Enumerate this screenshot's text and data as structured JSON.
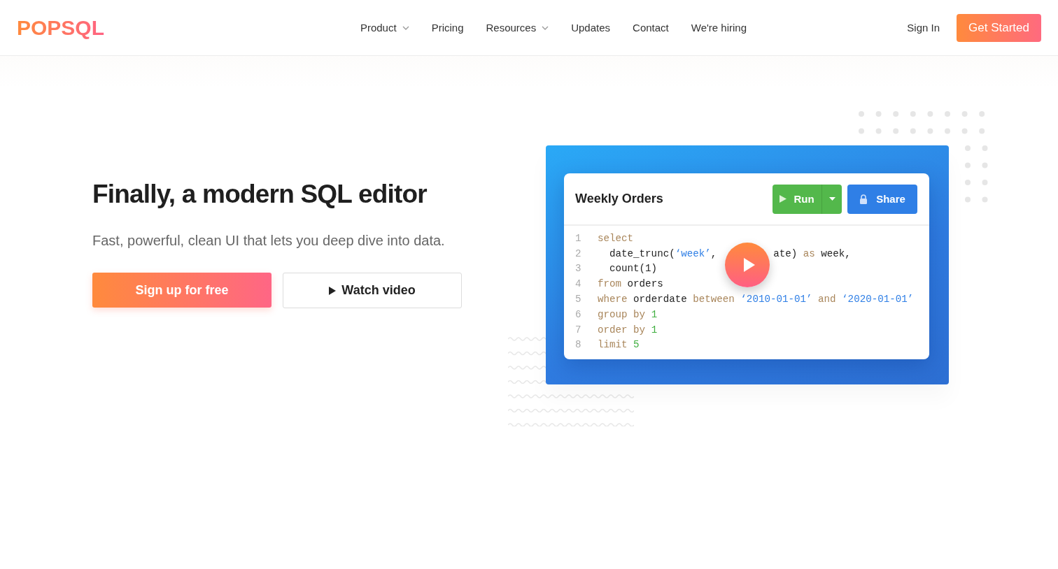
{
  "header": {
    "logo": "POPSQL",
    "nav": [
      {
        "label": "Product",
        "has_menu": true
      },
      {
        "label": "Pricing",
        "has_menu": false
      },
      {
        "label": "Resources",
        "has_menu": true
      },
      {
        "label": "Updates",
        "has_menu": false
      },
      {
        "label": "Contact",
        "has_menu": false
      },
      {
        "label": "We're hiring",
        "has_menu": false
      }
    ],
    "sign_in": "Sign In",
    "cta": "Get Started"
  },
  "hero": {
    "title": "Finally, a modern SQL editor",
    "subtitle": "Fast, powerful, clean UI that lets you deep dive into data.",
    "primary_button": "Sign up for free",
    "video_button": "Watch video"
  },
  "editor": {
    "title": "Weekly Orders",
    "run_button": "Run",
    "share_button": "Share",
    "lines": [
      {
        "number": "1",
        "tokens": [
          {
            "kind": "keyword",
            "text": "select"
          }
        ]
      },
      {
        "number": "2",
        "tokens": [
          {
            "kind": "plain",
            "text": "  date_trunc("
          },
          {
            "kind": "string",
            "text": "‘week’"
          },
          {
            "kind": "plain",
            "text": ", "
          },
          {
            "kind": "plain",
            "text": "ate)",
            "gap": true
          },
          {
            "kind": "keyword",
            "text": " as "
          },
          {
            "kind": "plain",
            "text": "week,"
          }
        ]
      },
      {
        "number": "3",
        "tokens": [
          {
            "kind": "plain",
            "text": "  count(1)"
          }
        ]
      },
      {
        "number": "4",
        "tokens": [
          {
            "kind": "keyword",
            "text": "from "
          },
          {
            "kind": "plain",
            "text": "orders"
          }
        ]
      },
      {
        "number": "5",
        "tokens": [
          {
            "kind": "keyword",
            "text": "where "
          },
          {
            "kind": "plain",
            "text": "orderdate "
          },
          {
            "kind": "keyword",
            "text": "between "
          },
          {
            "kind": "string",
            "text": "‘2010-01-01’"
          },
          {
            "kind": "keyword",
            "text": " and "
          },
          {
            "kind": "string",
            "text": "‘2020-01-01’"
          }
        ]
      },
      {
        "number": "6",
        "tokens": [
          {
            "kind": "keyword",
            "text": "group by "
          },
          {
            "kind": "number",
            "text": "1"
          }
        ]
      },
      {
        "number": "7",
        "tokens": [
          {
            "kind": "keyword",
            "text": "order by "
          },
          {
            "kind": "number",
            "text": "1"
          }
        ]
      },
      {
        "number": "8",
        "tokens": [
          {
            "kind": "keyword",
            "text": "limit "
          },
          {
            "kind": "number",
            "text": "5"
          }
        ]
      }
    ]
  }
}
